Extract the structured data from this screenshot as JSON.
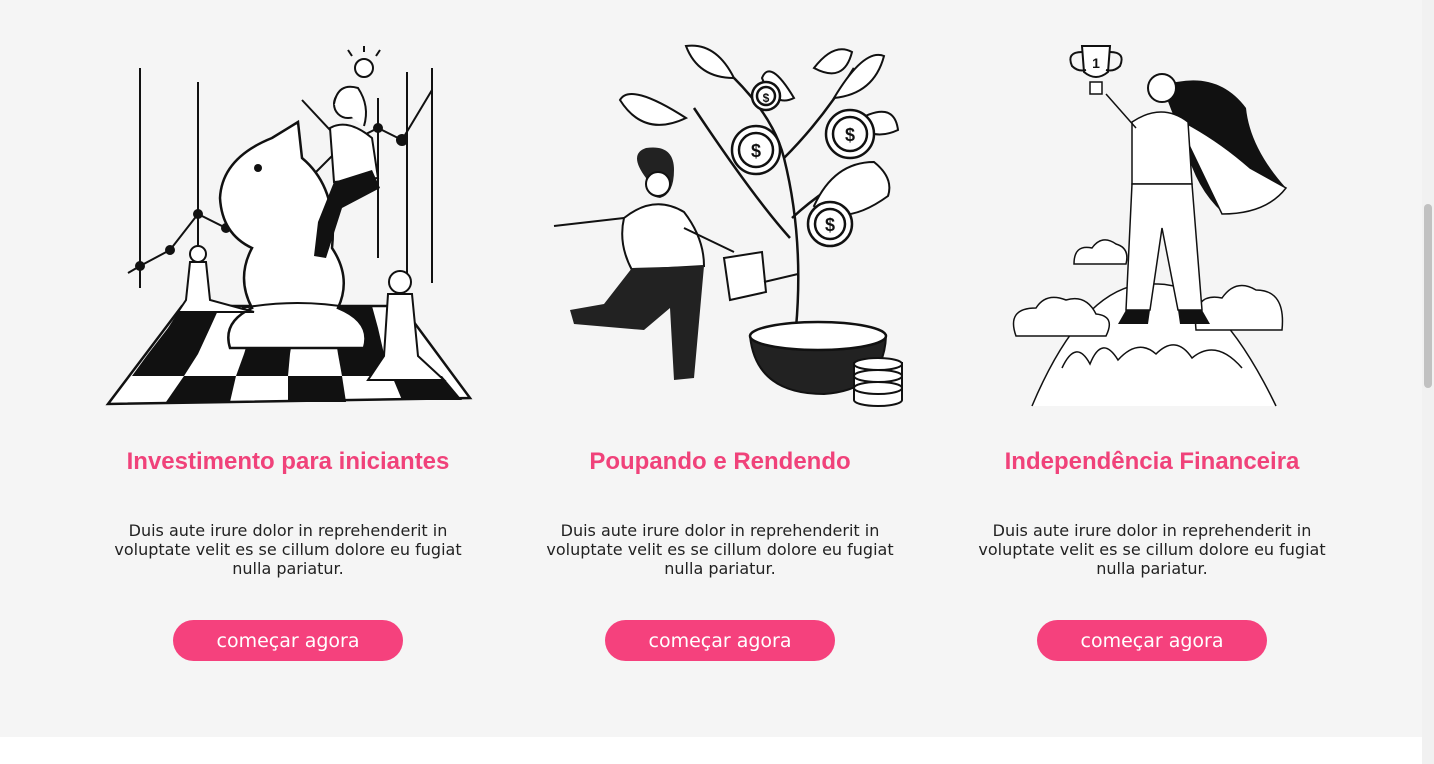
{
  "cards": [
    {
      "illustration": "chess-knight-rider-investing-illustration",
      "title": "Investimento para iniciantes",
      "description": "Duis aute irure dolor in reprehenderit in voluptate velit es se cillum dolore eu fugiat nulla pariatur.",
      "cta": "começar agora"
    },
    {
      "illustration": "woman-watering-money-tree-illustration",
      "title": "Poupando e Rendendo",
      "description": "Duis aute irure dolor in reprehenderit in voluptate velit es se cillum dolore eu fugiat nulla pariatur.",
      "cta": "começar agora"
    },
    {
      "illustration": "woman-holding-trophy-on-mountain-illustration",
      "title": "Independência Financeira",
      "description": "Duis aute irure dolor in reprehenderit in voluptate velit es se cillum dolore eu fugiat nulla pariatur.",
      "cta": "começar agora"
    }
  ],
  "colors": {
    "accent": "#f5417d",
    "title": "#f0427a",
    "background": "#f5f5f5",
    "text": "#222222"
  }
}
